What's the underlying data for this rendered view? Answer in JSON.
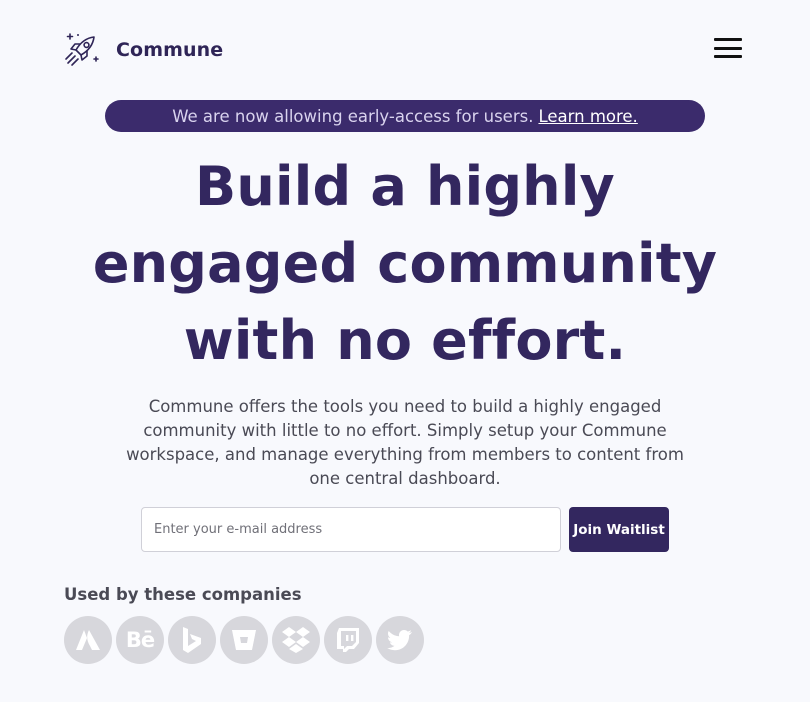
{
  "brand": {
    "name": "Commune",
    "logo_icon": "rocket-icon"
  },
  "header": {
    "menu_icon": "hamburger-menu-icon"
  },
  "banner": {
    "text": "We are now allowing early-access for users.",
    "link_label": "Learn more."
  },
  "hero": {
    "headline_lines": [
      "Build a highly",
      "engaged community",
      "with no effort."
    ],
    "description": "Commune offers the tools you need to build a highly engaged community with little to no effort. Simply setup your Commune workspace, and manage everything from members to content from one central dashboard."
  },
  "waitlist": {
    "email_placeholder": "Enter your e-mail address",
    "email_value": "",
    "button_label": "Join Waitlist"
  },
  "companies": {
    "title": "Used by these companies",
    "logos": [
      {
        "icon": "atlassian-icon"
      },
      {
        "icon": "behance-icon",
        "text": "Bē"
      },
      {
        "icon": "bing-icon"
      },
      {
        "icon": "bitbucket-icon"
      },
      {
        "icon": "dropbox-icon"
      },
      {
        "icon": "twitch-icon"
      },
      {
        "icon": "twitter-icon"
      }
    ]
  },
  "colors": {
    "primary": "#33275f",
    "banner_bg": "#3b2b6c",
    "page_bg": "#f8f9fd",
    "logo_circle": "#d7d7dc"
  }
}
